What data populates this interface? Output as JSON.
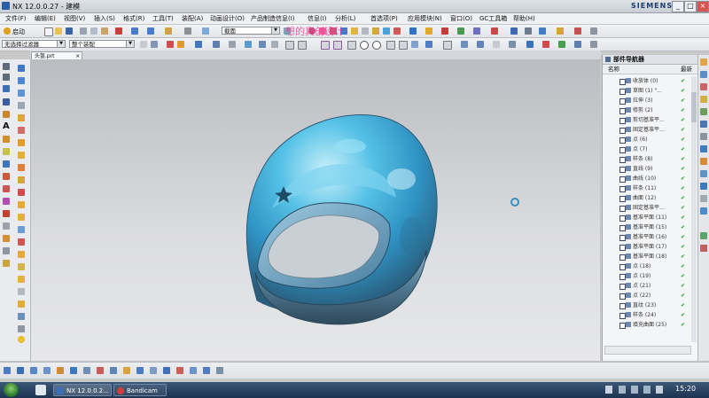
{
  "window": {
    "title": "NX 12.0.0.27 - 建模",
    "brand": "SIEMENS",
    "controls": [
      "_",
      "□",
      "×"
    ]
  },
  "menu": {
    "items": [
      "文件(F)",
      "编辑(E)",
      "视图(V)",
      "插入(S)",
      "格式(R)",
      "工具(T)",
      "装配(A)",
      "动画设计(O)",
      "产品制造信息(I)",
      "信息(I)",
      "分析(L)",
      "首选项(P)",
      "应用模块(N)",
      "窗口(O)",
      "GC工具箱",
      "帮助(H)"
    ]
  },
  "toolbar": {
    "start_label": "启动",
    "filter_value": "无选择过滤器",
    "assembly_value": "整个装配",
    "view_value": "截面"
  },
  "watermark": "想的真创设计",
  "document_tab": {
    "label": "头盔.prt",
    "close": "×"
  },
  "navigator": {
    "title": "部件导航器",
    "col_name": "名称",
    "col_latest": "最新",
    "rows": [
      "收放体 (0)",
      "草图 (1) \"...",
      "拉伸 (3)",
      "修剪 (2)",
      "剪切基准平...",
      "固定基准平...",
      "点 (6)",
      "点 (7)",
      "样条 (8)",
      "直线 (9)",
      "曲线 (10)",
      "样条 (11)",
      "曲面 (12)",
      "固定基准平...",
      "基准平面 (11)",
      "基准平面 (15)",
      "基准平面 (16)",
      "基准平面 (17)",
      "基准平面 (18)",
      "点 (18)",
      "点 (19)",
      "点 (21)",
      "点 (22)",
      "直纹 (23)",
      "样条 (24)",
      "填充曲面 (25)"
    ],
    "status": "✔"
  },
  "taskbar": {
    "items": [
      "NX 12.0.0.2...",
      "Bandicam"
    ],
    "time": "15:20"
  },
  "colors": {
    "helmet_blue": "#3aa9d9",
    "helmet_steel": "#5d7f97",
    "check_green": "#17a01e"
  }
}
